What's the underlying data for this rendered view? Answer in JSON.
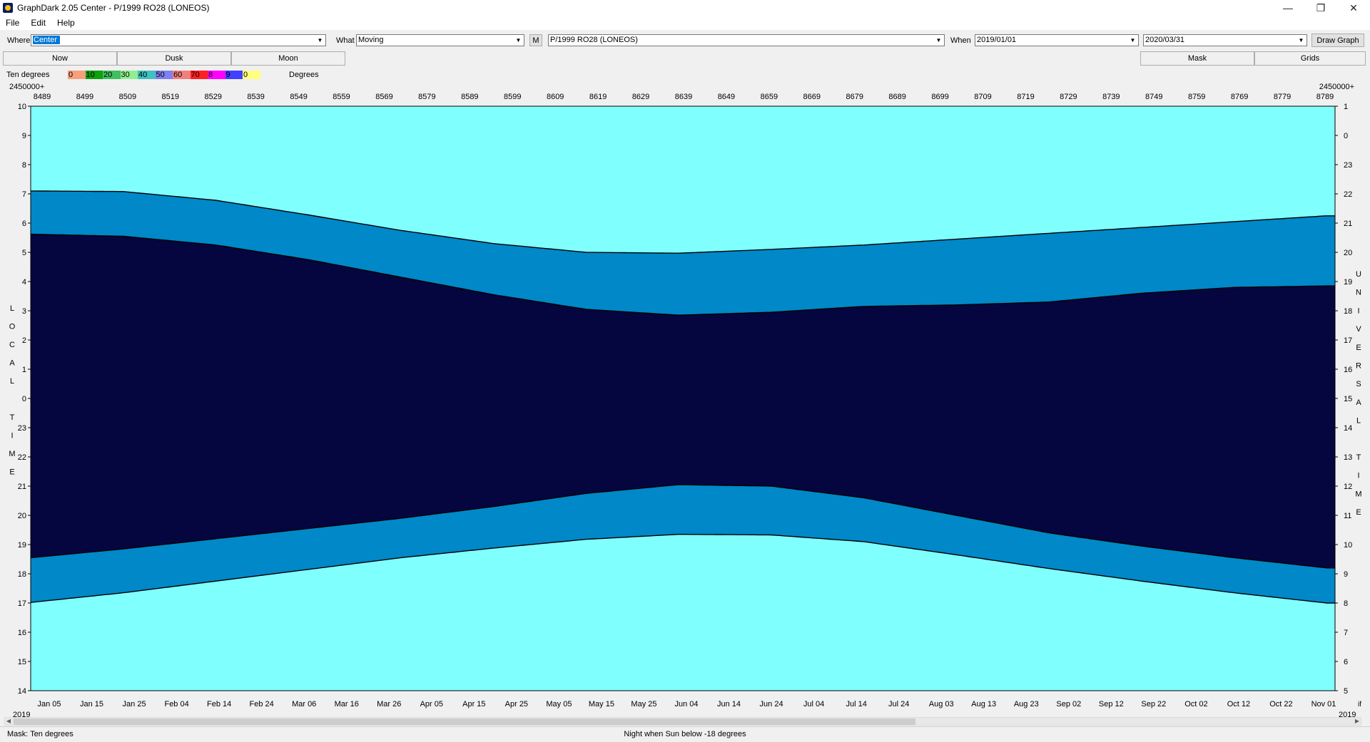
{
  "window": {
    "title": "GraphDark 2.05  Center  -  P/1999 RO28 (LONEOS)",
    "minimize": "—",
    "restore": "❐",
    "close": "✕"
  },
  "menu": [
    "File",
    "Edit",
    "Help"
  ],
  "toolbar": {
    "where_label": "Where",
    "where_value": "Center",
    "what_label": "What",
    "what_value": "Moving",
    "m_button": "M",
    "object_value": "P/1999 RO28 (LONEOS)",
    "when_label": "When",
    "start_date": "2019/01/01",
    "end_date": "2020/03/31",
    "draw_button": "Draw Graph"
  },
  "buttons": {
    "now": "Now",
    "dusk": "Dusk",
    "moon": "Moon",
    "mask": "Mask",
    "grids": "Grids"
  },
  "legend": {
    "label": "Ten degrees",
    "units": "Degrees",
    "stops": [
      {
        "label": "0",
        "color": "#f4a07a"
      },
      {
        "label": "10",
        "color": "#10a010"
      },
      {
        "label": "20",
        "color": "#40c060"
      },
      {
        "label": "30",
        "color": "#90ee90"
      },
      {
        "label": "40",
        "color": "#40c0c0"
      },
      {
        "label": "50",
        "color": "#8080f0"
      },
      {
        "label": "60",
        "color": "#f08080"
      },
      {
        "label": "70",
        "color": "#ff2020"
      },
      {
        "label": "8",
        "color": "#ff00ff"
      },
      {
        "label": "9",
        "color": "#4040ff"
      },
      {
        "label": "0",
        "color": "#ffff80"
      }
    ]
  },
  "chart_data": {
    "type": "heatmap",
    "title": "",
    "jd_prefix": "2450000+",
    "jd_ticks": [
      "8489",
      "8499",
      "8509",
      "8519",
      "8529",
      "8539",
      "8549",
      "8559",
      "8569",
      "8579",
      "8589",
      "8599",
      "8609",
      "8619",
      "8629",
      "8639",
      "8649",
      "8659",
      "8669",
      "8679",
      "8689",
      "8699",
      "8709",
      "8719",
      "8729",
      "8739",
      "8749",
      "8759",
      "8769",
      "8779",
      "8789"
    ],
    "date_ticks": [
      "Jan 05",
      "Jan 15",
      "Jan 25",
      "Feb 04",
      "Feb 14",
      "Feb 24",
      "Mar 06",
      "Mar 16",
      "Mar 26",
      "Apr 05",
      "Apr 15",
      "Apr 25",
      "May 05",
      "May 15",
      "May 25",
      "Jun 04",
      "Jun 14",
      "Jun 24",
      "Jul 04",
      "Jul 14",
      "Jul 24",
      "Aug 03",
      "Aug 13",
      "Aug 23",
      "Sep 02",
      "Sep 12",
      "Sep 22",
      "Oct 02",
      "Oct 12",
      "Oct 22",
      "Nov 01"
    ],
    "year_left": "2019",
    "year_right": "2019",
    "right_corner": "if",
    "left_axis_title": [
      "L",
      "O",
      "C",
      "A",
      "L",
      "",
      "T",
      "I",
      "M",
      "E"
    ],
    "right_axis_title": [
      "U",
      "N",
      "I",
      "V",
      "E",
      "R",
      "S",
      "A",
      "L",
      "",
      "T",
      "I",
      "M",
      "E"
    ],
    "left_ticks": [
      "10",
      "9",
      "8",
      "7",
      "6",
      "5",
      "4",
      "3",
      "2",
      "1",
      "0",
      "23",
      "22",
      "21",
      "20",
      "19",
      "18",
      "17",
      "16",
      "15",
      "14"
    ],
    "right_ticks": [
      "1",
      "0",
      "23",
      "22",
      "21",
      "20",
      "19",
      "18",
      "17",
      "16",
      "15",
      "14",
      "13",
      "12",
      "11",
      "10",
      "9",
      "8",
      "7",
      "6",
      "5"
    ],
    "x_range_days": [
      0,
      310
    ],
    "sunset_local": [
      17.02,
      17.35,
      17.75,
      18.15,
      18.55,
      18.88,
      19.18,
      19.35,
      19.33,
      19.1,
      18.65,
      18.18,
      17.75,
      17.35,
      17.0
    ],
    "dusk_local": [
      18.55,
      18.85,
      19.2,
      19.55,
      19.9,
      20.3,
      20.75,
      21.05,
      21.0,
      20.6,
      20.0,
      19.4,
      18.95,
      18.55,
      18.2
    ],
    "dawn_local": [
      5.62,
      5.55,
      5.25,
      4.75,
      4.15,
      3.55,
      3.05,
      2.85,
      2.95,
      3.15,
      3.2,
      3.3,
      3.6,
      3.8,
      3.85
    ],
    "sunrise_local": [
      7.1,
      7.08,
      6.78,
      6.28,
      5.75,
      5.3,
      5.0,
      4.97,
      5.1,
      5.25,
      5.45,
      5.65,
      5.85,
      6.05,
      6.25
    ],
    "curve_days": [
      0,
      22,
      44,
      66,
      88,
      110,
      132,
      154,
      176,
      198,
      220,
      242,
      264,
      286,
      308
    ],
    "colors": {
      "sky": "#80ffff",
      "night": "#050540",
      "twilight": "#0088c8",
      "moon": "#d0d0d8"
    }
  },
  "status": {
    "mask": "Mask:  Ten degrees",
    "center": "Night when Sun below -18 degrees"
  }
}
